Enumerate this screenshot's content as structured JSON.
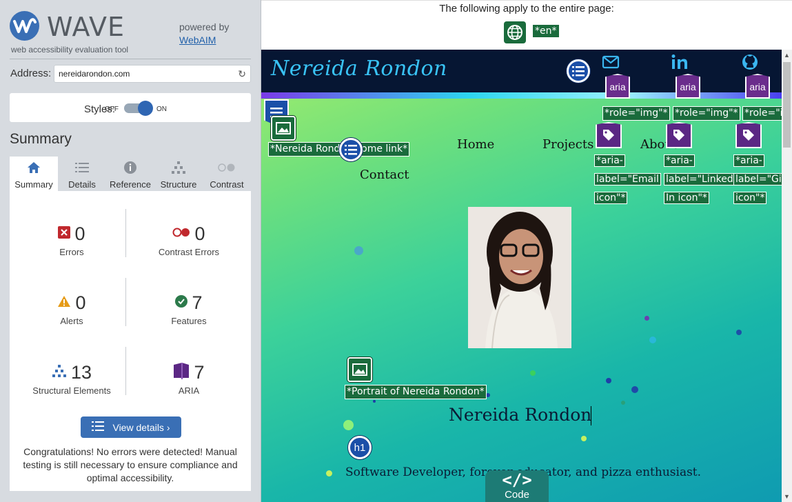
{
  "wave": {
    "logo_text": "WAVE",
    "tagline": "web accessibility evaluation tool",
    "powered_by": "powered by",
    "webaim_link": "WebAIM",
    "address_label": "Address:",
    "address_value": "nereidarondon.com",
    "styles_label": "Styles:",
    "styles_off": "OFF",
    "styles_on": "ON",
    "styles_enabled": true,
    "summary_title": "Summary",
    "tabs": [
      {
        "label": "Summary",
        "icon": "home-icon",
        "active": true
      },
      {
        "label": "Details",
        "icon": "list-icon",
        "active": false
      },
      {
        "label": "Reference",
        "icon": "info-icon",
        "active": false
      },
      {
        "label": "Structure",
        "icon": "structure-icon",
        "active": false
      },
      {
        "label": "Contrast",
        "icon": "contrast-icon",
        "active": false
      }
    ],
    "stats": {
      "errors": {
        "count": "0",
        "label": "Errors",
        "color": "#c0282d"
      },
      "contrast_errors": {
        "count": "0",
        "label": "Contrast Errors",
        "color": "#c0282d"
      },
      "alerts": {
        "count": "0",
        "label": "Alerts",
        "color": "#e69b17"
      },
      "features": {
        "count": "7",
        "label": "Features",
        "color": "#2c7a4b"
      },
      "structural": {
        "count": "13",
        "label": "Structural Elements",
        "color": "#3a6fb5"
      },
      "aria": {
        "count": "7",
        "label": "ARIA",
        "color": "#5b2784"
      }
    },
    "view_details": "View details ›",
    "congrats": "Congratulations! No errors were detected! Manual testing is still necessary to ensure compliance and optimal accessibility."
  },
  "topbar": {
    "text": "The following apply to the entire page:",
    "lang_tag": "*en*"
  },
  "site": {
    "brand": "Nereida Rondon",
    "nav": {
      "home": "Home",
      "projects": "Projects",
      "about": "About",
      "contact": "Contact"
    },
    "home_link_tag": "*Nereida Rondon home link*",
    "aria_badge": "aria",
    "role_img": "*role=\"img\"*",
    "aria_labels": [
      [
        "*aria-",
        "label=\"Email",
        "icon\"*"
      ],
      [
        "*aria-",
        "label=\"Linked",
        "In icon\"*"
      ],
      [
        "*aria-",
        "label=\"Gith",
        "icon\"*"
      ]
    ],
    "portrait_tag": "*Portrait of Nereida Rondon*",
    "hero_name": "Nereida Rondon",
    "h1_badge": "h1",
    "hero_sub": "Software Developer, forever educator, and pizza enthusiast.",
    "code_tab": "Code",
    "code_glyph": "</>"
  }
}
